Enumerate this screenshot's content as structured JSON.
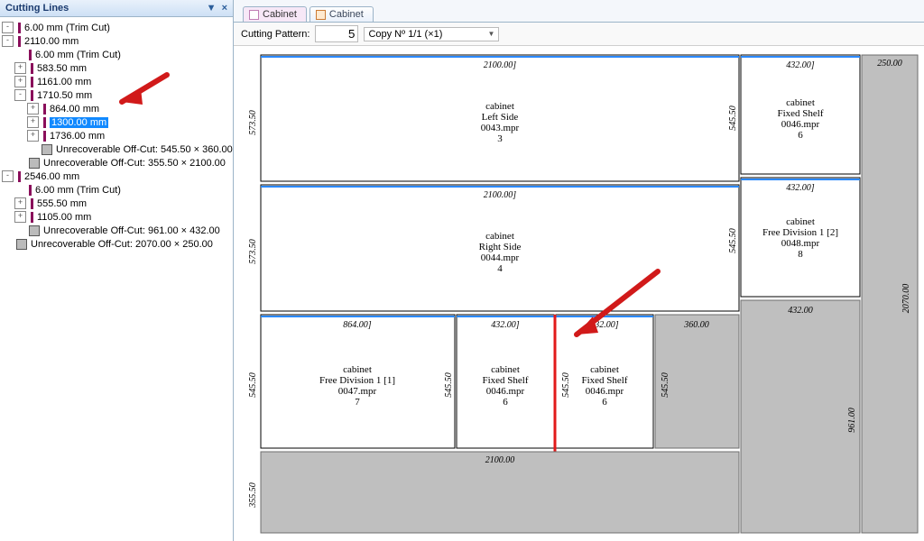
{
  "panel": {
    "title": "Cutting Lines",
    "pin_icon": "▼",
    "close_icon": "×"
  },
  "tree": [
    {
      "indent": 0,
      "tw": "-",
      "kind": "bar",
      "text": "6.00 mm (Trim Cut)"
    },
    {
      "indent": 0,
      "tw": "-",
      "kind": "bar",
      "text": "2110.00 mm"
    },
    {
      "indent": 1,
      "tw": " ",
      "kind": "bar",
      "text": "6.00 mm (Trim Cut)"
    },
    {
      "indent": 1,
      "tw": "+",
      "kind": "bar",
      "text": "583.50 mm"
    },
    {
      "indent": 1,
      "tw": "+",
      "kind": "bar",
      "text": "1161.00 mm"
    },
    {
      "indent": 1,
      "tw": "-",
      "kind": "bar",
      "text": "1710.50 mm"
    },
    {
      "indent": 2,
      "tw": "+",
      "kind": "bar",
      "text": "864.00 mm"
    },
    {
      "indent": 2,
      "tw": "+",
      "kind": "bar",
      "text": "1300.00 mm",
      "selected": true
    },
    {
      "indent": 2,
      "tw": "+",
      "kind": "bar",
      "text": "1736.00 mm"
    },
    {
      "indent": 2,
      "tw": " ",
      "kind": "sq",
      "text": "Unrecoverable Off-Cut: 545.50 × 360.00"
    },
    {
      "indent": 1,
      "tw": " ",
      "kind": "sq",
      "text": "Unrecoverable Off-Cut: 355.50 × 2100.00"
    },
    {
      "indent": 0,
      "tw": "-",
      "kind": "bar",
      "text": "2546.00 mm"
    },
    {
      "indent": 1,
      "tw": " ",
      "kind": "bar",
      "text": "6.00 mm (Trim Cut)"
    },
    {
      "indent": 1,
      "tw": "+",
      "kind": "bar",
      "text": "555.50 mm"
    },
    {
      "indent": 1,
      "tw": "+",
      "kind": "bar",
      "text": "1105.00 mm"
    },
    {
      "indent": 1,
      "tw": " ",
      "kind": "sq",
      "text": "Unrecoverable Off-Cut: 961.00 × 432.00"
    },
    {
      "indent": 0,
      "tw": " ",
      "kind": "sq",
      "text": "Unrecoverable Off-Cut: 2070.00 × 250.00"
    }
  ],
  "tabs": {
    "t1": "Cabinet",
    "t2": "Cabinet"
  },
  "toolbar": {
    "label": "Cutting Pattern:",
    "pattern_no": "5",
    "copy_text": "Copy Nº 1/1 (×1)"
  },
  "outer": {
    "right": "250.00",
    "rvert": "2070.00"
  },
  "p1": {
    "w": "2100.00]",
    "h": "573.50",
    "name": "cabinet",
    "sub": "Left Side",
    "file": "0043.mpr",
    "num": "3"
  },
  "p2": {
    "w": "432.00]",
    "h": "545.50",
    "name": "cabinet",
    "sub": "Fixed Shelf",
    "file": "0046.mpr",
    "num": "6"
  },
  "p3": {
    "w": "2100.00]",
    "h": "573.50",
    "name": "cabinet",
    "sub": "Right Side",
    "file": "0044.mpr",
    "num": "4"
  },
  "p4": {
    "w": "432.00]",
    "h": "545.50",
    "name": "cabinet",
    "sub": "Free Division 1 [2]",
    "file": "0048.mpr",
    "num": "8"
  },
  "p5": {
    "w": "864.00]",
    "h": "545.50",
    "name": "cabinet",
    "sub": "Free Division 1 [1]",
    "file": "0047.mpr",
    "num": "7"
  },
  "p6": {
    "w": "432.00]",
    "h": "545.50",
    "name": "cabinet",
    "sub": "Fixed Shelf",
    "file": "0046.mpr",
    "num": "6"
  },
  "p7": {
    "w": "432.00]",
    "h": "545.50",
    "name": "cabinet",
    "sub": "Fixed Shelf",
    "file": "0046.mpr",
    "num": "6"
  },
  "o1": {
    "w": "360.00",
    "h": "545.50"
  },
  "o2": {
    "w": "432.00",
    "h": "961.00"
  },
  "o3": {
    "w": "2100.00",
    "h": "355.50"
  }
}
